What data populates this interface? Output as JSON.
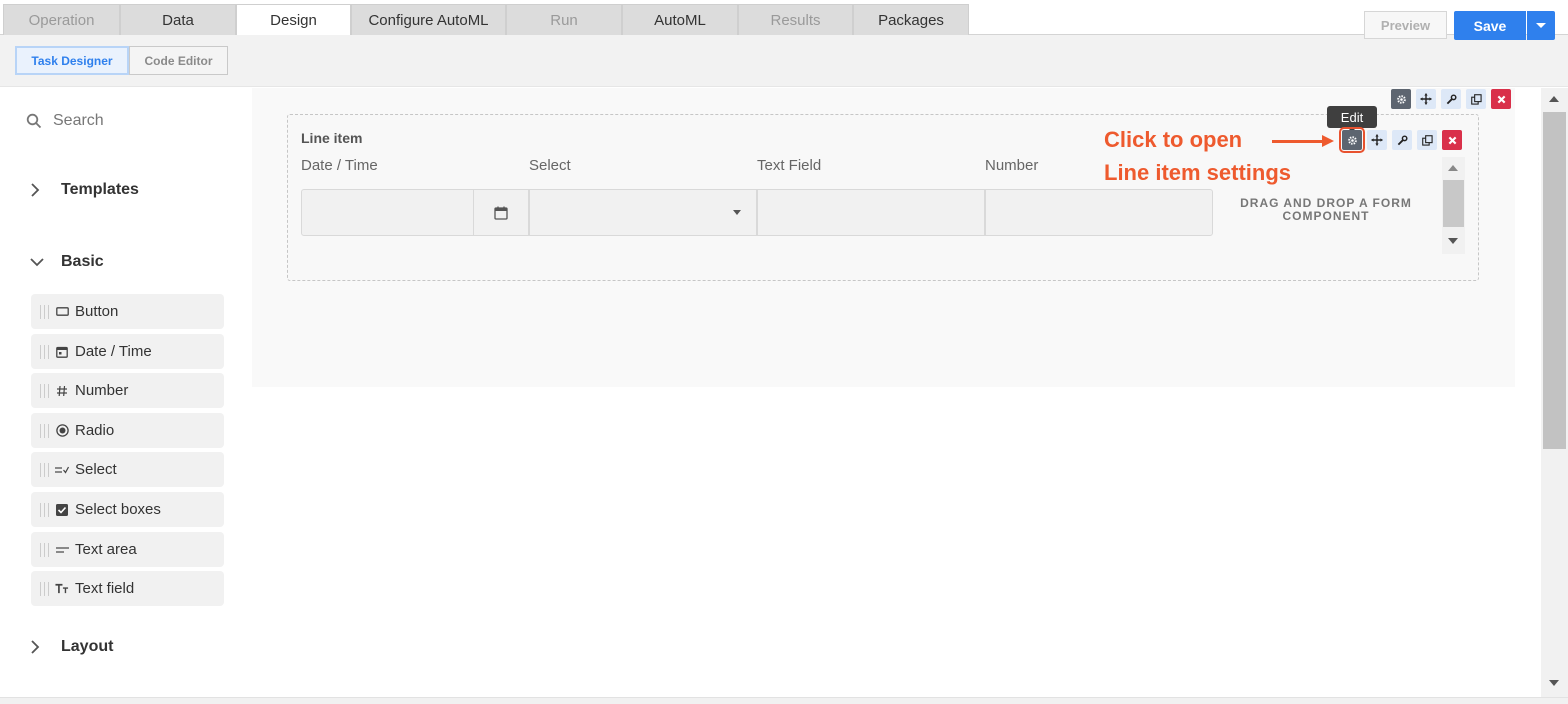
{
  "tabs": [
    {
      "label": "Operation",
      "state": "disabled"
    },
    {
      "label": "Data",
      "state": "normal"
    },
    {
      "label": "Design",
      "state": "active"
    },
    {
      "label": "Configure AutoML",
      "state": "normal"
    },
    {
      "label": "Run",
      "state": "disabled"
    },
    {
      "label": "AutoML",
      "state": "normal"
    },
    {
      "label": "Results",
      "state": "disabled"
    },
    {
      "label": "Packages",
      "state": "normal"
    }
  ],
  "toolbar": {
    "task_designer": "Task Designer",
    "code_editor": "Code Editor",
    "preview": "Preview",
    "save": "Save"
  },
  "sidebar": {
    "search_placeholder": "Search",
    "groups": {
      "templates": "Templates",
      "basic": "Basic",
      "layout": "Layout"
    },
    "components": [
      {
        "label": "Button",
        "icon": "button-icon"
      },
      {
        "label": "Date / Time",
        "icon": "calendar-icon"
      },
      {
        "label": "Number",
        "icon": "hash-icon"
      },
      {
        "label": "Radio",
        "icon": "radio-icon"
      },
      {
        "label": "Select",
        "icon": "select-list-icon"
      },
      {
        "label": "Select boxes",
        "icon": "checkbox-icon"
      },
      {
        "label": "Text area",
        "icon": "text-area-icon"
      },
      {
        "label": "Text field",
        "icon": "text-field-icon"
      }
    ]
  },
  "canvas": {
    "line_item_title": "Line item",
    "columns": [
      "Date / Time",
      "Select",
      "Text Field",
      "Number"
    ],
    "dropzone_text": "DRAG AND DROP A FORM COMPONENT",
    "tooltip": "Edit"
  },
  "annotation": {
    "line1": "Click to open",
    "line2": "Line item settings",
    "color": "#ee5a2e"
  },
  "colors": {
    "accent": "#2f80ed",
    "danger": "#d9304a"
  }
}
